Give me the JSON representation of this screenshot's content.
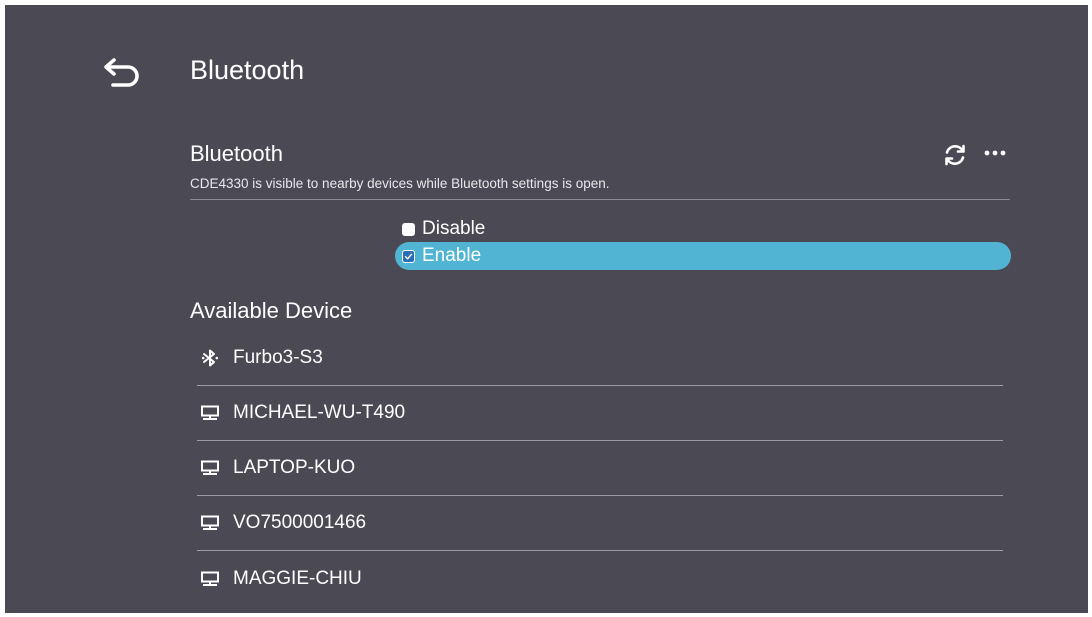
{
  "header": {
    "title": "Bluetooth",
    "back_icon": "back-arrow-icon"
  },
  "bluetooth_section": {
    "title": "Bluetooth",
    "subtitle": "CDE4330 is visible to nearby devices while Bluetooth settings is open.",
    "refresh_icon": "refresh-icon",
    "more_icon": "more-horizontal-icon"
  },
  "toggle_options": [
    {
      "label": "Disable",
      "checked": false
    },
    {
      "label": "Enable",
      "checked": true
    }
  ],
  "available_section": {
    "title": "Available Device"
  },
  "devices": [
    {
      "name": "Furbo3-S3",
      "icon": "bluetooth-icon"
    },
    {
      "name": "MICHAEL-WU-T490",
      "icon": "computer-icon"
    },
    {
      "name": "LAPTOP-KUO",
      "icon": "computer-icon"
    },
    {
      "name": "VO7500001466",
      "icon": "computer-icon"
    },
    {
      "name": "MAGGIE-CHIU",
      "icon": "computer-icon"
    }
  ],
  "colors": {
    "background": "#4a4954",
    "highlight": "#50b4d2",
    "text": "#ffffff",
    "divider": "#8a8a93"
  }
}
